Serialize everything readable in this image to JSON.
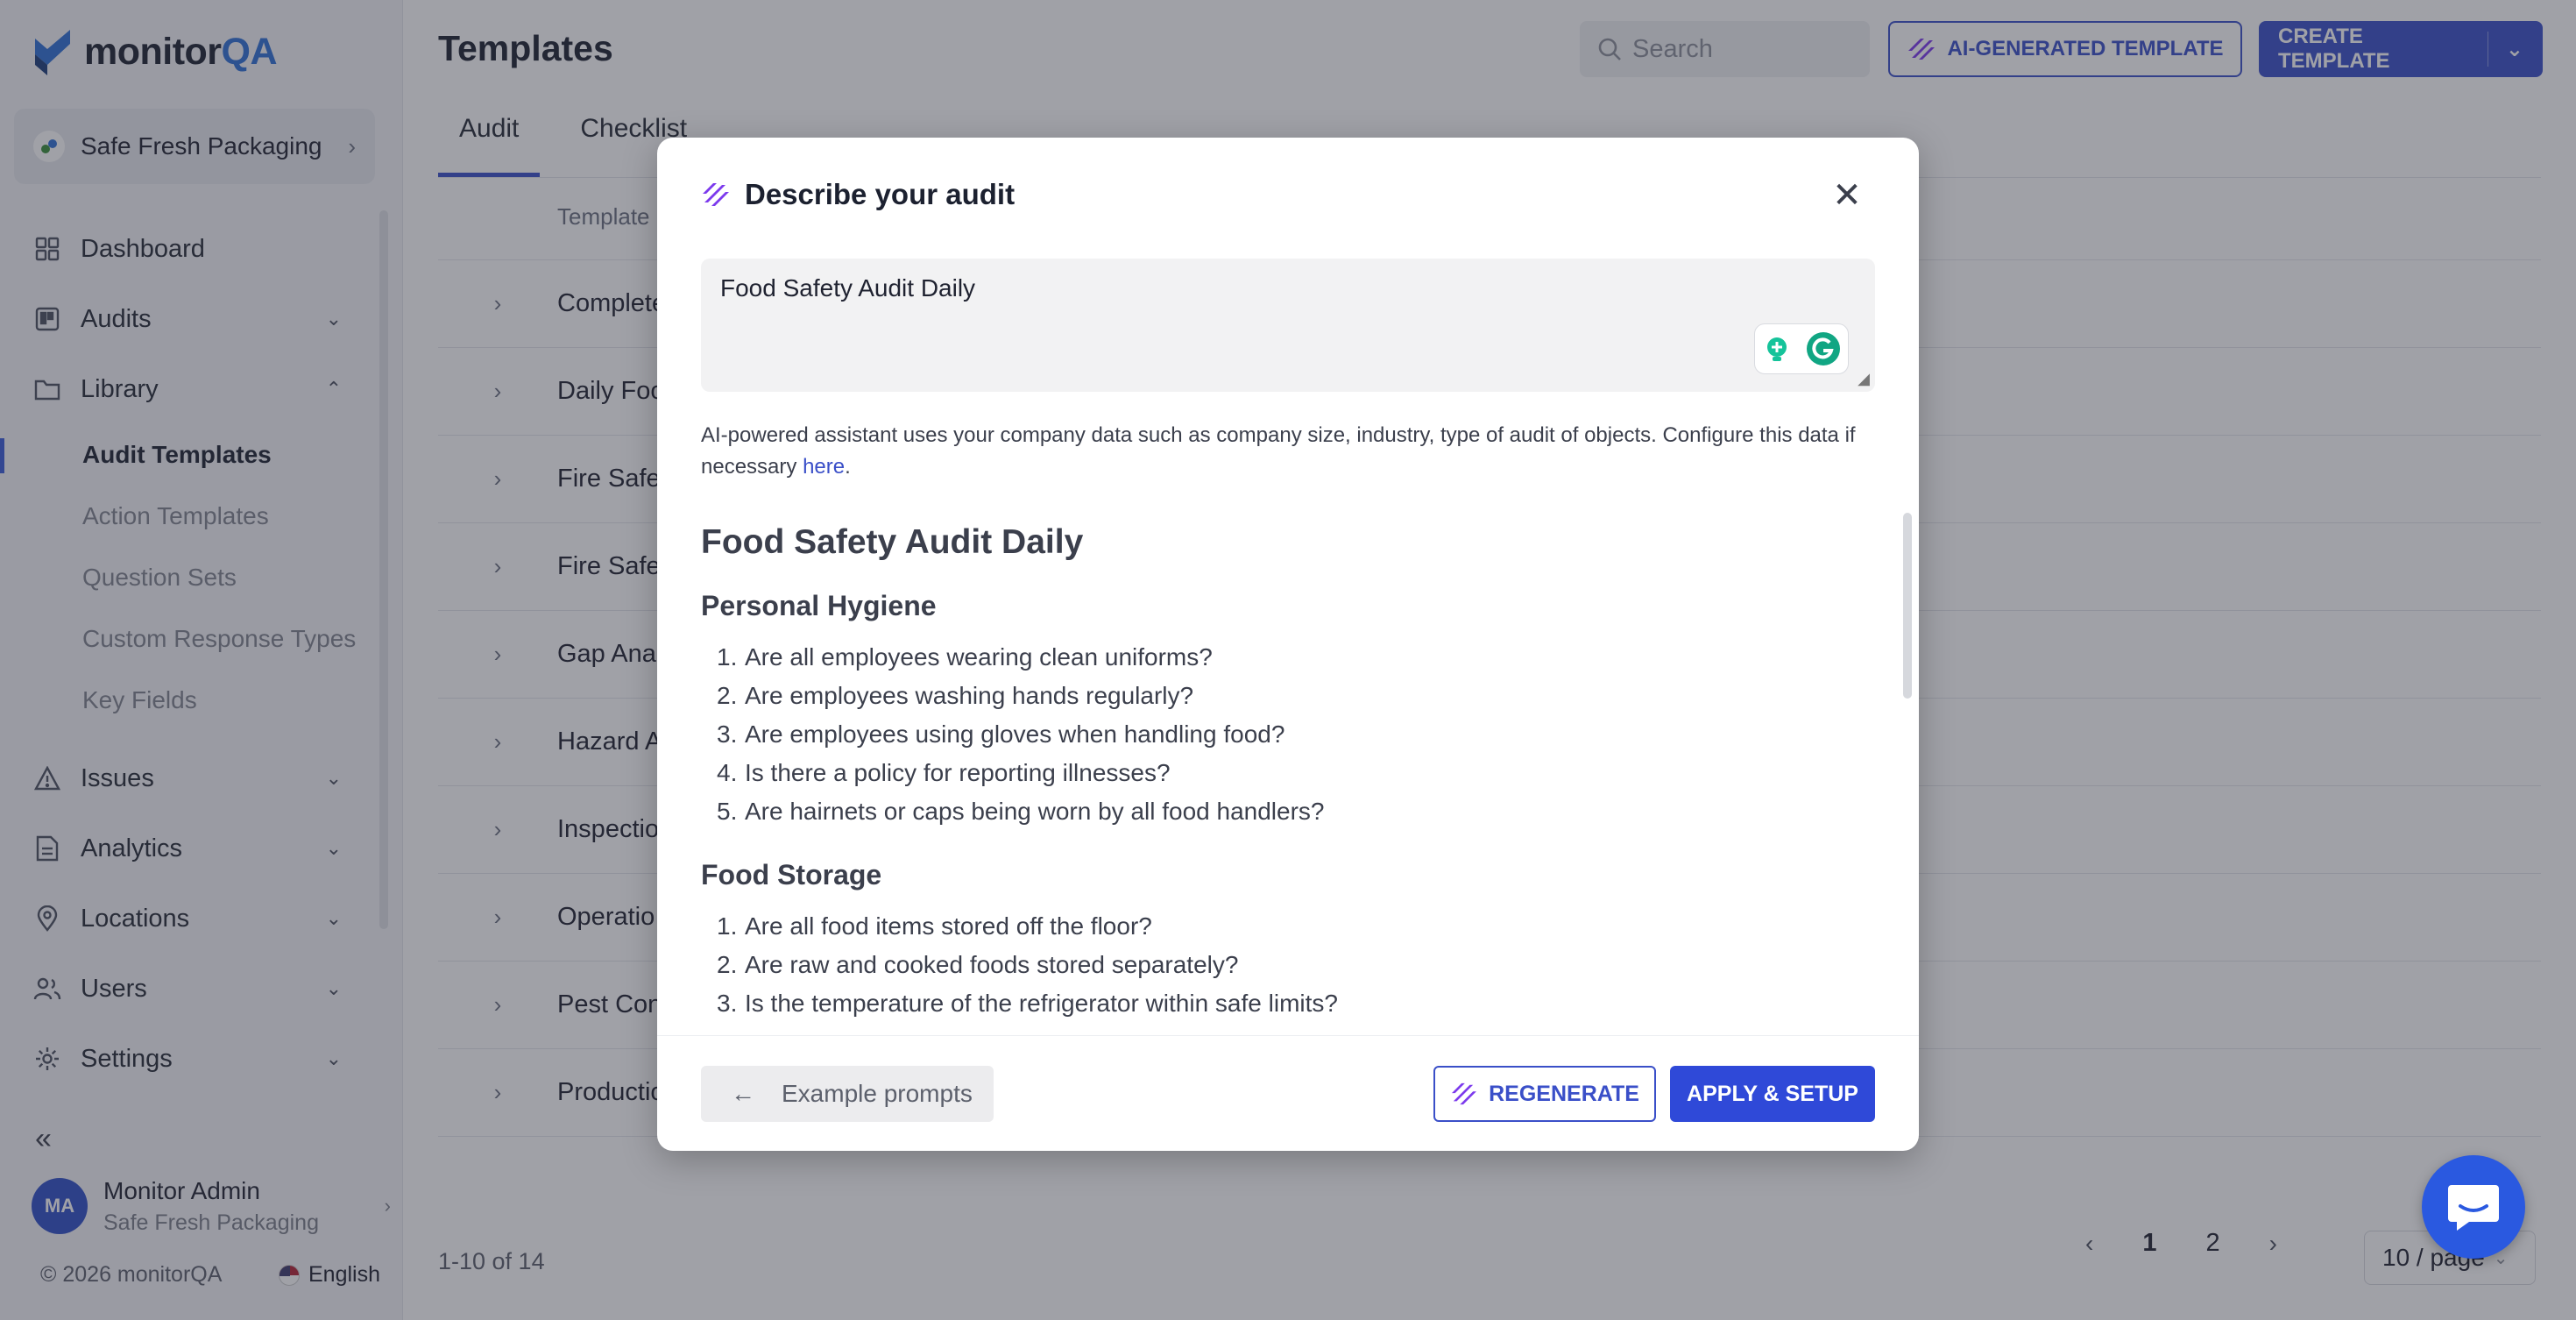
{
  "sidebar": {
    "logo": {
      "text_main": "monitor",
      "text_accent": "QA"
    },
    "org_switcher": {
      "name": "Safe Fresh Packaging"
    },
    "nav": {
      "dashboard": "Dashboard",
      "audits": "Audits",
      "library": "Library",
      "library_items": [
        "Audit Templates",
        "Action Templates",
        "Question Sets",
        "Custom Response Types",
        "Key Fields"
      ],
      "issues": "Issues",
      "analytics": "Analytics",
      "locations": "Locations",
      "users": "Users",
      "settings": "Settings"
    },
    "user": {
      "initials": "MA",
      "name": "Monitor Admin",
      "org": "Safe Fresh Packaging"
    },
    "footer": {
      "copyright": "© 2026 monitorQA",
      "language": "English"
    }
  },
  "header": {
    "title": "Templates",
    "search_placeholder": "Search",
    "ai_button": "AI-GENERATED TEMPLATE",
    "create_button": "CREATE TEMPLATE"
  },
  "tabs": [
    "Audit",
    "Checklist"
  ],
  "table": {
    "header": "Template",
    "rows": [
      "Complete",
      "Daily Foo",
      "Fire Safe",
      "Fire Safe",
      "Gap Ana",
      "Hazard A",
      "Inspectio",
      "Operatio",
      "Pest Con",
      "Productio"
    ]
  },
  "pagination": {
    "range": "1-10 of 14",
    "pages": [
      "1",
      "2"
    ],
    "current": "1",
    "page_size": "10 / page"
  },
  "modal": {
    "title": "Describe your audit",
    "prompt_value": "Food Safety Audit Daily",
    "helper_text": "AI-powered assistant uses your company data such as company size, industry, type of audit of objects. Configure this data if necessary ",
    "helper_link": "here",
    "helper_end": ".",
    "result": {
      "title": "Food Safety Audit Daily",
      "sections": [
        {
          "heading": "Personal Hygiene",
          "items": [
            "Are all employees wearing clean uniforms?",
            "Are employees washing hands regularly?",
            "Are employees using gloves when handling food?",
            "Is there a policy for reporting illnesses?",
            "Are hairnets or caps being worn by all food handlers?"
          ]
        },
        {
          "heading": "Food Storage",
          "items": [
            "Are all food items stored off the floor?",
            "Are raw and cooked foods stored separately?",
            "Is the temperature of the refrigerator within safe limits?"
          ]
        }
      ]
    },
    "footer": {
      "examples_button": "Example prompts",
      "regenerate_button": "REGENERATE",
      "apply_button": "APPLY & SETUP"
    }
  },
  "colors": {
    "accent": "#3a4fc8",
    "primary_button": "#2f49d8",
    "chat_fab": "#2a59e0"
  }
}
